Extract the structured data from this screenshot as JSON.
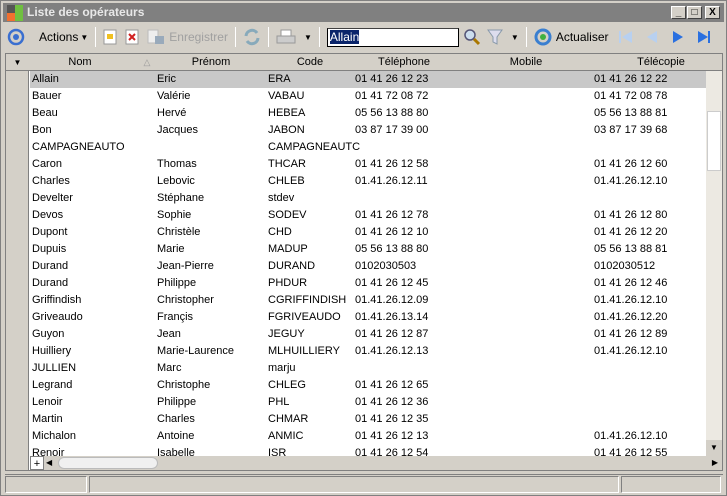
{
  "window": {
    "title": "Liste des opérateurs",
    "controls": [
      "_",
      "□",
      "X"
    ]
  },
  "toolbar": {
    "actions_label": "Actions",
    "save_label": "Enregistrer",
    "search_value": "Allain",
    "refresh_label": "Actualiser"
  },
  "columns": [
    "Nom",
    "Prénom",
    "Code",
    "Téléphone",
    "Mobile",
    "Télécopie"
  ],
  "rows": [
    [
      "Allain",
      "Eric",
      "ERA",
      "01 41 26 12 23",
      "",
      "01 41 26 12 22"
    ],
    [
      "Bauer",
      "Valérie",
      "VABAU",
      "01 41 72 08 72",
      "",
      "01 41 72 08 78"
    ],
    [
      "Beau",
      "Hervé",
      "HEBEA",
      "05 56 13 88 80",
      "",
      "05 56 13 88 81"
    ],
    [
      "Bon",
      "Jacques",
      "JABON",
      "03 87 17 39 00",
      "",
      "03 87 17 39 68"
    ],
    [
      "CAMPAGNEAUTO",
      "",
      "CAMPAGNEAUTC",
      "",
      "",
      ""
    ],
    [
      "Caron",
      "Thomas",
      "THCAR",
      "01 41 26 12 58",
      "",
      "01 41 26 12 60"
    ],
    [
      "Charles",
      "Lebovic",
      "CHLEB",
      "01.41.26.12.11",
      "",
      "01.41.26.12.10"
    ],
    [
      "Develter",
      "Stéphane",
      "stdev",
      "",
      "",
      ""
    ],
    [
      "Devos",
      "Sophie",
      "SODEV",
      "01 41 26 12 78",
      "",
      "01 41 26 12 80"
    ],
    [
      "Dupont",
      "Christèle",
      "CHD",
      "01 41 26 12 10",
      "",
      "01 41 26 12 20"
    ],
    [
      "Dupuis",
      "Marie",
      "MADUP",
      "05 56 13 88 80",
      "",
      "05 56 13 88 81"
    ],
    [
      "Durand",
      "Jean-Pierre",
      "DURAND",
      "0102030503",
      "",
      "0102030512"
    ],
    [
      "Durand",
      "Philippe",
      "PHDUR",
      "01 41 26 12 45",
      "",
      "01 41 26 12 46"
    ],
    [
      "Griffindish",
      "Christopher",
      "CGRIFFINDISH",
      "01.41.26.12.09",
      "",
      "01.41.26.12.10"
    ],
    [
      "Griveaudo",
      "Françis",
      "FGRIVEAUDO",
      "01.41.26.13.14",
      "",
      "01.41.26.12.20"
    ],
    [
      "Guyon",
      "Jean",
      "JEGUY",
      "01 41 26 12 87",
      "",
      "01 41 26 12 89"
    ],
    [
      "Huilliery",
      "Marie-Laurence",
      "MLHUILLIERY",
      "01.41.26.12.13",
      "",
      "01.41.26.12.10"
    ],
    [
      "JULLIEN",
      "Marc",
      "marju",
      "",
      "",
      ""
    ],
    [
      "Legrand",
      "Christophe",
      "CHLEG",
      "01 41 26 12 65",
      "",
      ""
    ],
    [
      "Lenoir",
      "Philippe",
      "PHL",
      "01 41 26 12 36",
      "",
      ""
    ],
    [
      "Martin",
      "Charles",
      "CHMAR",
      "01 41 26 12 35",
      "",
      ""
    ],
    [
      "Michalon",
      "Antoine",
      "ANMIC",
      "01 41 26 12 13",
      "",
      "01.41.26.12.10"
    ],
    [
      "Renoir",
      "Isabelle",
      "ISR",
      "01 41 26 12 54",
      "",
      "01 41 26 12 55"
    ]
  ],
  "selected_row": 0
}
